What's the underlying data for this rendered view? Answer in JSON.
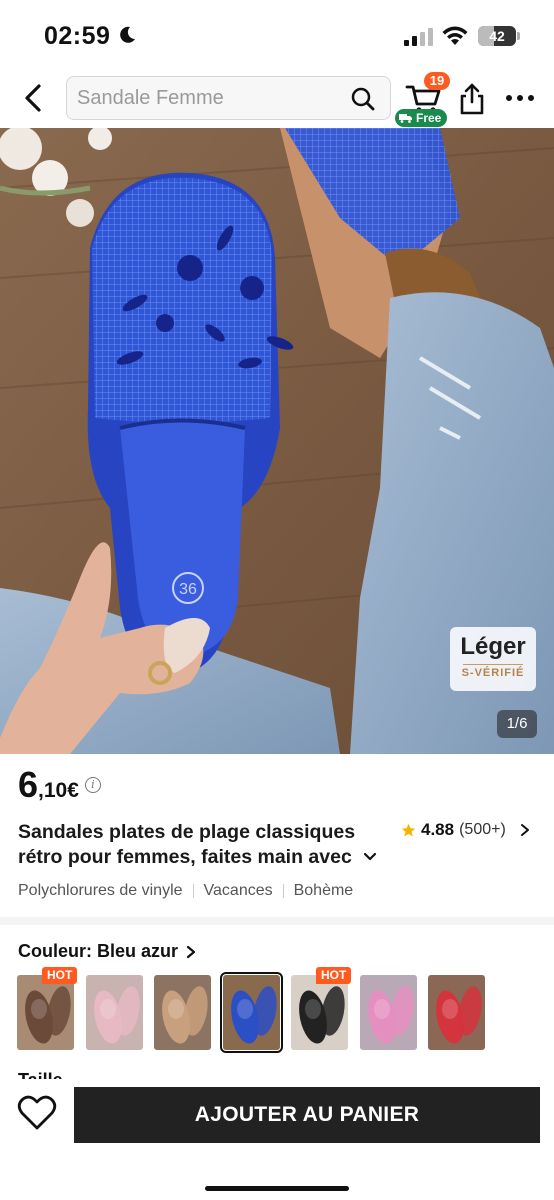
{
  "status_bar": {
    "time": "02:59",
    "battery_level": "42",
    "battery_fraction": 0.42
  },
  "nav": {
    "search_placeholder": "Sandale Femme",
    "cart_count": "19",
    "free_label": "Free"
  },
  "hero": {
    "badge_title": "Léger",
    "badge_subtitle": "S-VÉRIFIÉ",
    "counter": "1/6",
    "size_mark": "36"
  },
  "product": {
    "price_int": "6",
    "price_dec": ",10",
    "currency": "€",
    "info_icon": "i",
    "title_line1": "Sandales plates de plage classiques",
    "title_line2": "rétro pour femmes, faites main avec",
    "rating": "4.88",
    "reviews": "(500+)",
    "tags": [
      "Polychlorures de vinyle",
      "Vacances",
      "Bohème"
    ]
  },
  "colors": {
    "label": "Couleur: Bleu azur",
    "swatches": [
      {
        "name": "brown-floral",
        "hot": true,
        "bg": "#a98a73",
        "shoe": "#6b4a3a"
      },
      {
        "name": "pink-lace",
        "hot": false,
        "bg": "#c9b3b0",
        "shoe": "#e6b9c3"
      },
      {
        "name": "tan-flower",
        "hot": false,
        "bg": "#8d7462",
        "shoe": "#c9a07e"
      },
      {
        "name": "blue-azure",
        "hot": false,
        "bg": "#8a6a4d",
        "shoe": "#2b4fc4",
        "selected": true
      },
      {
        "name": "black-beaded",
        "hot": true,
        "bg": "#d8cfc7",
        "shoe": "#222222"
      },
      {
        "name": "pink-mesh",
        "hot": false,
        "bg": "#b9a8b6",
        "shoe": "#e58fc0"
      },
      {
        "name": "red-mesh",
        "hot": false,
        "bg": "#8a6855",
        "shoe": "#d3343e"
      }
    ],
    "hot_label": "HOT"
  },
  "size_label": "Taille",
  "bottom": {
    "add_to_cart": "AJOUTER AU PANIER"
  }
}
